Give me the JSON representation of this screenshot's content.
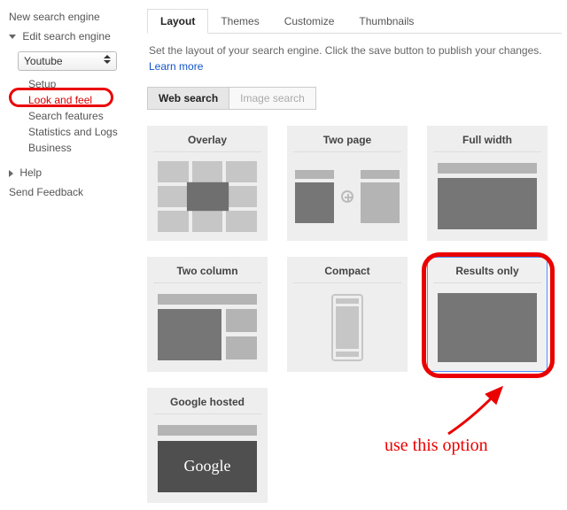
{
  "sidebar": {
    "new_engine": "New search engine",
    "edit_engine": "Edit search engine",
    "selected_engine": "Youtube",
    "items": [
      "Setup",
      "Look and feel",
      "Search features",
      "Statistics and Logs",
      "Business"
    ],
    "help": "Help",
    "feedback": "Send Feedback"
  },
  "tabs": {
    "items": [
      "Layout",
      "Themes",
      "Customize",
      "Thumbnails"
    ],
    "active": "Layout"
  },
  "instructions": {
    "text": "Set the layout of your search engine. Click the save button to publish your changes. ",
    "link": "Learn more"
  },
  "subtabs": {
    "web": "Web search",
    "image": "Image search"
  },
  "cards": {
    "overlay": "Overlay",
    "two_page": "Two page",
    "full_width": "Full width",
    "two_column": "Two column",
    "compact": "Compact",
    "results_only": "Results only",
    "google_hosted": "Google hosted",
    "google_logo": "Google"
  },
  "annotation": {
    "text": "use this option"
  }
}
